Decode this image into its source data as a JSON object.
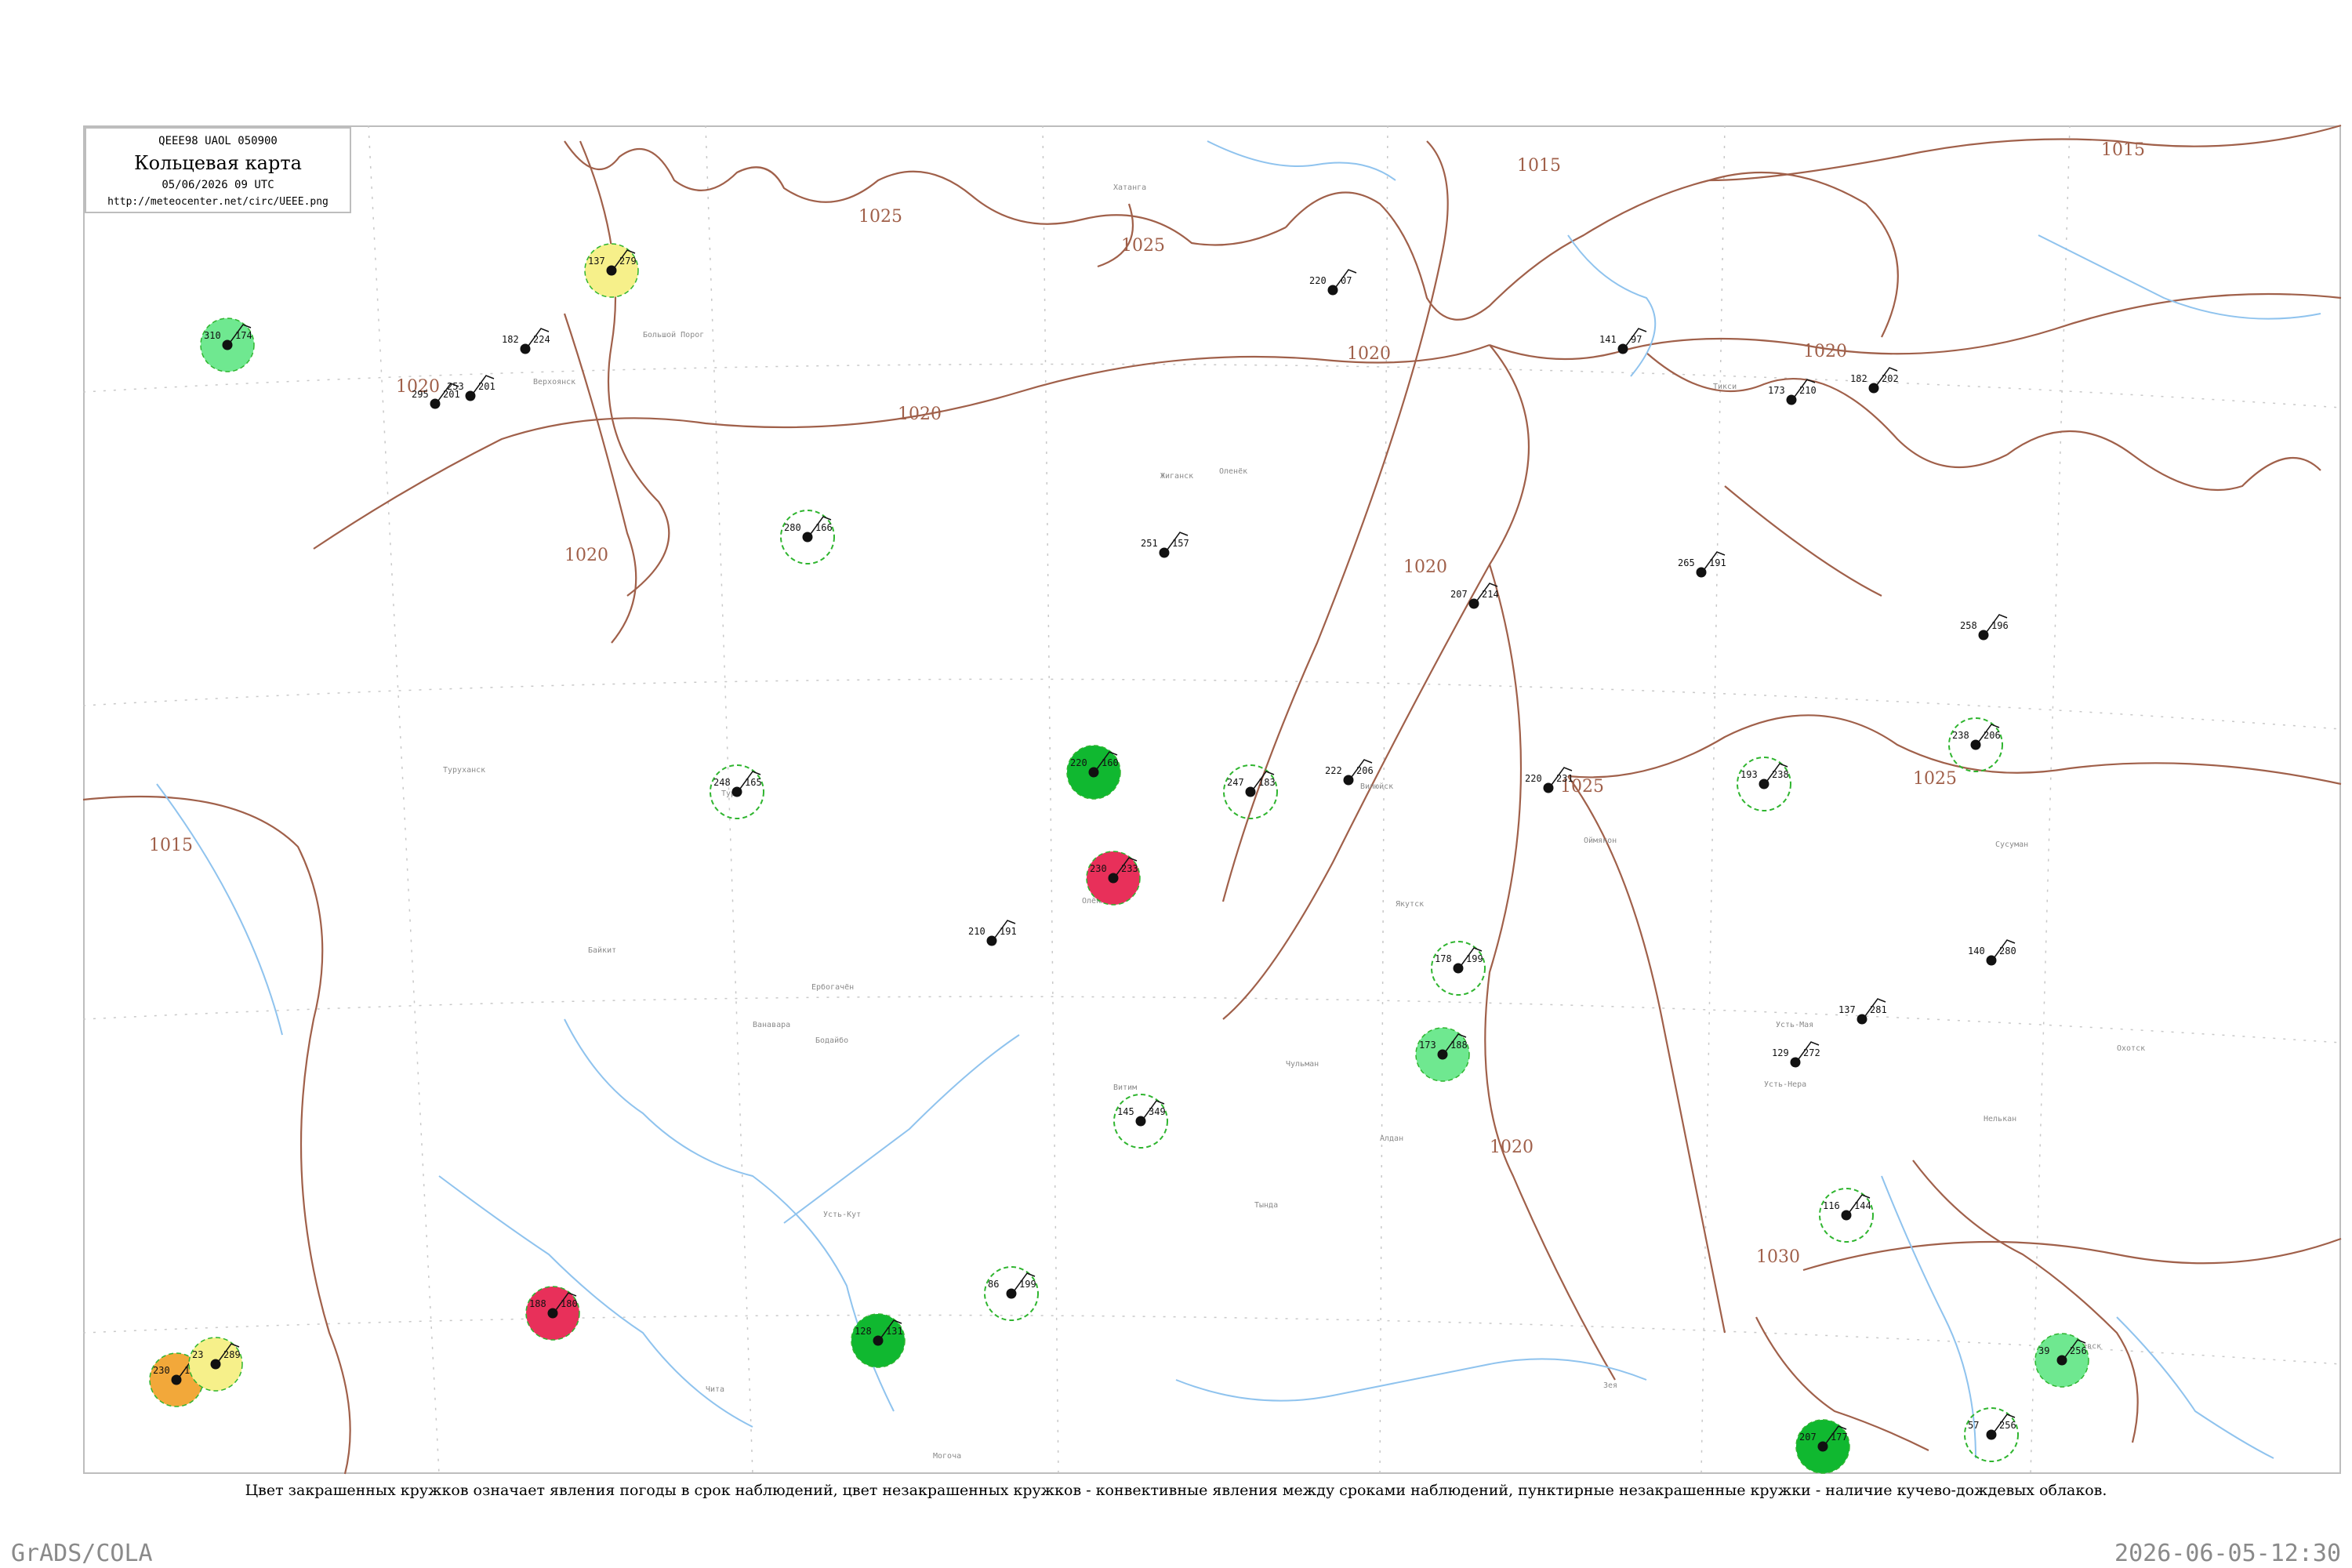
{
  "header": {
    "code_line": "QEEE98  UAOL  050900",
    "title": "Кольцевая карта",
    "datetime": "05/06/2026 09 UTC",
    "url": "http://meteocenter.net/circ/UEEE.png"
  },
  "caption": "Цвет закрашенных кружков означает явления погоды в срок наблюдений, цвет незакрашенных кружков - конвективные явления между сроками наблюдений, пунктирные незакрашенные кружки - наличие кучево-дождевых облаков.",
  "footer": {
    "left": "GrADS/COLA",
    "right": "2026-06-05-12:30"
  },
  "colors": {
    "isobar": "#a0604a",
    "river": "#8fc3ee",
    "dashed_circle": "#2fb52f",
    "fill_green_dark": "#10b830",
    "fill_green_light": "#6fe890",
    "fill_red": "#e8305a",
    "fill_orange": "#f2a83a",
    "fill_yellow": "#f6f08a"
  },
  "isobars": [
    {
      "label": "1025"
    },
    {
      "label": "1025"
    },
    {
      "label": "1015"
    },
    {
      "label": "1015"
    },
    {
      "label": "1020"
    },
    {
      "label": "1020"
    },
    {
      "label": "1020"
    },
    {
      "label": "1020"
    },
    {
      "label": "1020"
    },
    {
      "label": "1020"
    },
    {
      "label": "1025"
    },
    {
      "label": "1025"
    },
    {
      "label": "1015"
    },
    {
      "label": "1020"
    },
    {
      "label": "1030"
    }
  ],
  "station_labels": [
    {
      "text": "Тикси"
    },
    {
      "text": "Верхоянск"
    },
    {
      "text": "Жиганск"
    },
    {
      "text": "Оленёк"
    },
    {
      "text": "Вилюйск"
    },
    {
      "text": "Якутск"
    },
    {
      "text": "Олёкминск"
    },
    {
      "text": "Усть-Кут"
    },
    {
      "text": "Витим"
    },
    {
      "text": "Туруханск"
    },
    {
      "text": "Ванавара"
    },
    {
      "text": "Ербогачён"
    },
    {
      "text": "Тура"
    },
    {
      "text": "Байкит"
    },
    {
      "text": "Чульман"
    },
    {
      "text": "Оймякон"
    },
    {
      "text": "Сусуман"
    },
    {
      "text": "Усть-Мая"
    },
    {
      "text": "Усть-Нера"
    },
    {
      "text": "Алдан"
    },
    {
      "text": "Зея"
    },
    {
      "text": "Тында"
    },
    {
      "text": "Могоча"
    },
    {
      "text": "Чита"
    },
    {
      "text": "Бодайбо"
    },
    {
      "text": "Охотск"
    },
    {
      "text": "Нелькан"
    },
    {
      "text": "Николаевск"
    },
    {
      "text": "Большой Порог"
    },
    {
      "text": "Хатанга"
    }
  ],
  "observations": [
    {
      "t": "137",
      "p": "279",
      "fill": "yellow"
    },
    {
      "t": "182",
      "p": "224",
      "fill": "none"
    },
    {
      "t": "220",
      "p": "07",
      "fill": "none"
    },
    {
      "t": "141",
      "p": "97",
      "fill": "none"
    },
    {
      "t": "173",
      "p": "210",
      "fill": "none"
    },
    {
      "t": "182",
      "p": "202",
      "fill": "none"
    },
    {
      "t": "295",
      "p": "201",
      "fill": "none"
    },
    {
      "t": "310",
      "p": "174",
      "fill": "green_light"
    },
    {
      "t": "253",
      "p": "201",
      "fill": "none"
    },
    {
      "t": "280",
      "p": "166",
      "fill": "dashed"
    },
    {
      "t": "251",
      "p": "157",
      "fill": "none"
    },
    {
      "t": "265",
      "p": "191",
      "fill": "none"
    },
    {
      "t": "207",
      "p": "214",
      "fill": "none"
    },
    {
      "t": "258",
      "p": "196",
      "fill": "none"
    },
    {
      "t": "248",
      "p": "165",
      "fill": "dashed"
    },
    {
      "t": "220",
      "p": "160",
      "fill": "green_dark"
    },
    {
      "t": "247",
      "p": "183",
      "fill": "dashed"
    },
    {
      "t": "222",
      "p": "206",
      "fill": "none"
    },
    {
      "t": "220",
      "p": "231",
      "fill": "none"
    },
    {
      "t": "193",
      "p": "238",
      "fill": "dashed"
    },
    {
      "t": "238",
      "p": "206",
      "fill": "dashed"
    },
    {
      "t": "230",
      "p": "233",
      "fill": "red"
    },
    {
      "t": "210",
      "p": "191",
      "fill": "none"
    },
    {
      "t": "178",
      "p": "199",
      "fill": "dashed"
    },
    {
      "t": "173",
      "p": "188",
      "fill": "green_light"
    },
    {
      "t": "145",
      "p": "349",
      "fill": "dashed"
    },
    {
      "t": "188",
      "p": "180",
      "fill": "red"
    },
    {
      "t": "128",
      "p": "131",
      "fill": "green_dark"
    },
    {
      "t": "86",
      "p": "199",
      "fill": "dashed"
    },
    {
      "t": "230",
      "p": "188",
      "fill": "orange"
    },
    {
      "t": "23",
      "p": "289",
      "fill": "yellow"
    },
    {
      "t": "39",
      "p": "256",
      "fill": "green_light"
    },
    {
      "t": "207",
      "p": "177",
      "fill": "green_dark"
    },
    {
      "t": "116",
      "p": "144",
      "fill": "dashed"
    },
    {
      "t": "129",
      "p": "272",
      "fill": "none"
    },
    {
      "t": "137",
      "p": "281",
      "fill": "none"
    },
    {
      "t": "140",
      "p": "280",
      "fill": "none"
    },
    {
      "t": "57",
      "p": "256",
      "fill": "dashed"
    }
  ]
}
